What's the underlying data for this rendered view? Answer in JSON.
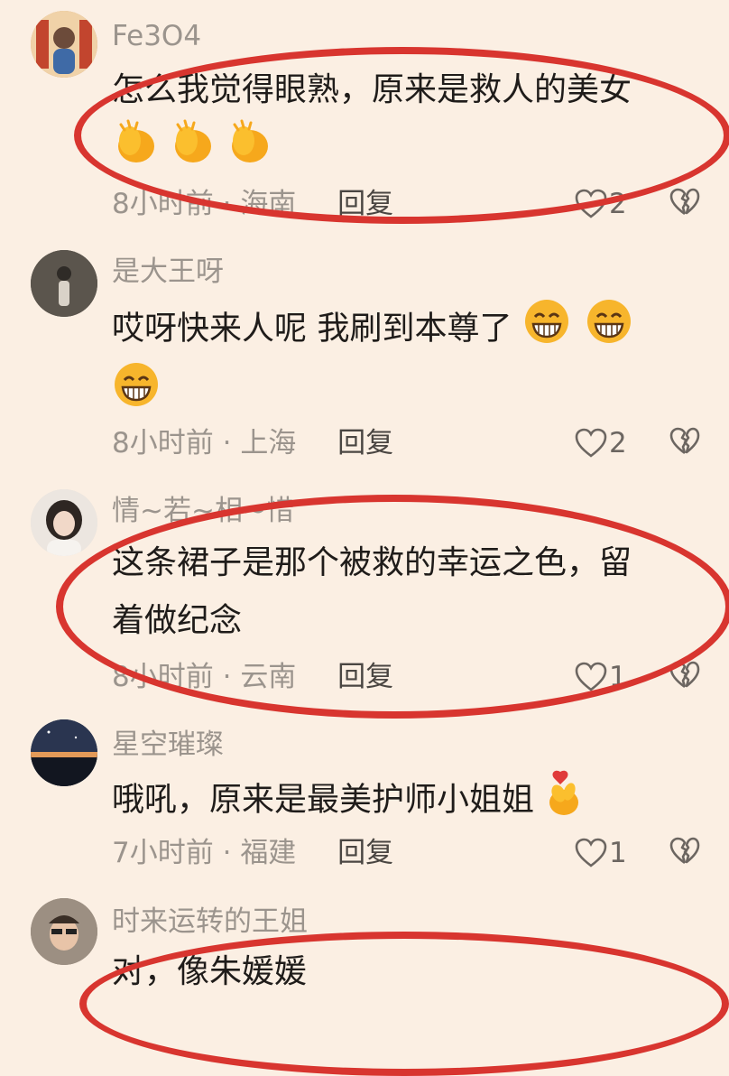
{
  "comments": [
    {
      "username": "Fe3O4",
      "text": "怎么我觉得眼熟，原来是救人的美女",
      "time": "8小时前",
      "location": "海南",
      "reply": "回复",
      "likes": "2",
      "emoji": "clapping-hands-icon"
    },
    {
      "username": "是大王呀",
      "text": "哎呀快来人呢 我刷到本尊了",
      "time": "8小时前",
      "location": "上海",
      "reply": "回复",
      "likes": "2",
      "emoji": "grinning-face-icon"
    },
    {
      "username": "情~若~相~惜",
      "text_line1": "这条裙子是那个被救的幸运之色，留",
      "text_line2": "着做纪念",
      "time": "8小时前",
      "location": "云南",
      "reply": "回复",
      "likes": "1"
    },
    {
      "username": "星空璀璨",
      "text": "哦吼，原来是最美护师小姐姐",
      "time": "7小时前",
      "location": "福建",
      "reply": "回复",
      "likes": "1",
      "emoji": "finger-heart-icon"
    },
    {
      "username": "时来运转的王姐",
      "text": "对，像朱媛媛"
    }
  ],
  "colors": {
    "background": "#fbefe3",
    "annotation_circle": "#d8352f",
    "secondary_text": "#9b948d"
  }
}
